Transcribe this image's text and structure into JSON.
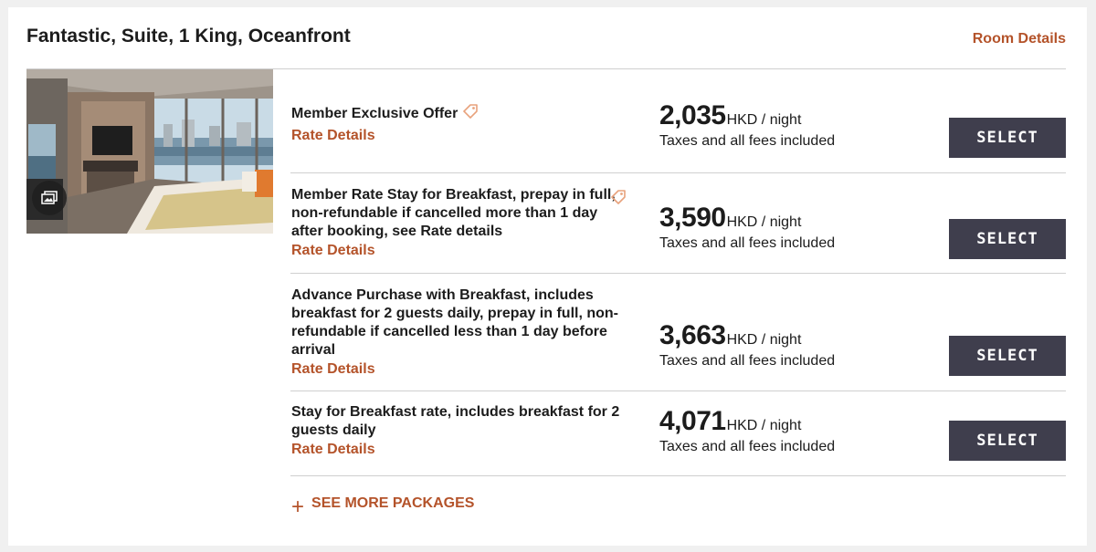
{
  "room": {
    "title": "Fantastic, Suite, 1 King, Oceanfront",
    "details_link": "Room Details"
  },
  "rates": [
    {
      "name": "Member Exclusive Offer",
      "has_tag": true,
      "details_label": "Rate Details",
      "price": "2,035",
      "unit": "HKD / night",
      "note": "Taxes and all fees included",
      "button": "SELECT"
    },
    {
      "name": "Member Rate Stay for Breakfast, prepay in full, non-refundable if cancelled more than 1 day after booking, see Rate details",
      "has_tag": true,
      "details_label": "Rate Details",
      "price": "3,590",
      "unit": "HKD / night",
      "note": "Taxes and all fees included",
      "button": "SELECT"
    },
    {
      "name": "Advance Purchase with Breakfast, includes breakfast for 2 guests daily, prepay in full, non-refundable if cancelled less than 1 day before arrival",
      "has_tag": false,
      "details_label": "Rate Details",
      "price": "3,663",
      "unit": "HKD / night",
      "note": "Taxes and all fees included",
      "button": "SELECT"
    },
    {
      "name": "Stay for Breakfast rate, includes breakfast for 2 guests daily",
      "has_tag": false,
      "details_label": "Rate Details",
      "price": "4,071",
      "unit": "HKD / night",
      "note": "Taxes and all fees included",
      "button": "SELECT"
    }
  ],
  "see_more": {
    "icon": "plus-icon",
    "label": "SEE MORE PACKAGES"
  },
  "colors": {
    "accent": "#b4532a",
    "button": "#3f3e4d",
    "tag_icon": "#e8a27c"
  }
}
